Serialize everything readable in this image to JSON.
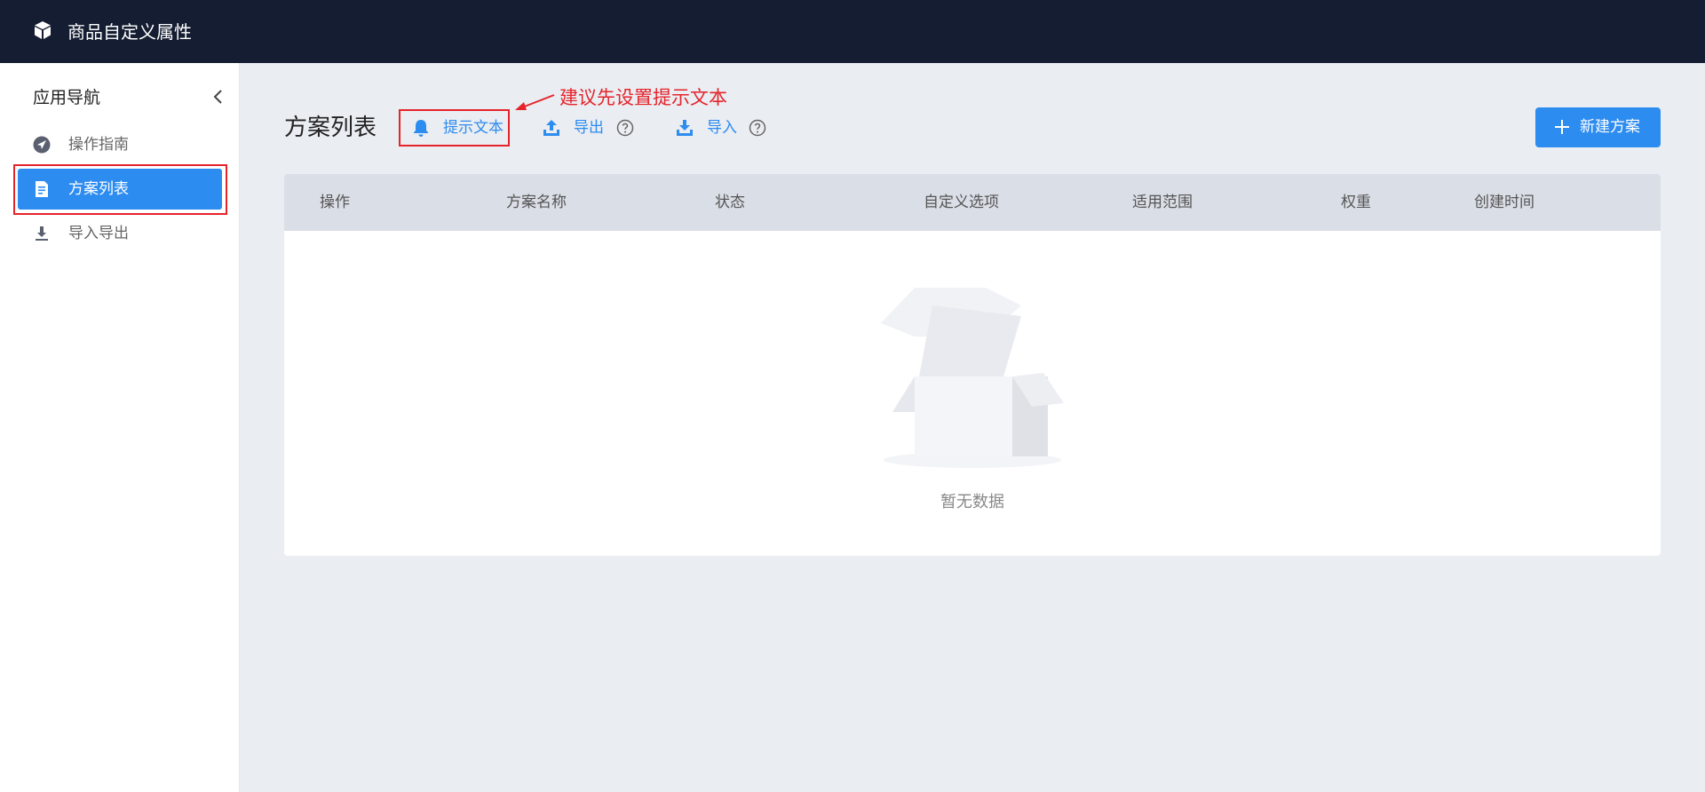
{
  "header": {
    "title": "商品自定义属性",
    "logo_icon": "cube-icon"
  },
  "sidebar": {
    "title": "应用导航",
    "items": [
      {
        "label": "操作指南",
        "icon": "compass-icon",
        "active": false
      },
      {
        "label": "方案列表",
        "icon": "document-icon",
        "active": true
      },
      {
        "label": "导入导出",
        "icon": "download-icon",
        "active": false
      }
    ]
  },
  "main": {
    "title": "方案列表",
    "toolbar": {
      "hint_label": "提示文本",
      "export_label": "导出",
      "import_label": "导入"
    },
    "annotation": "建议先设置提示文本",
    "new_button_label": "新建方案"
  },
  "table": {
    "columns": [
      "操作",
      "方案名称",
      "状态",
      "自定义选项",
      "适用范围",
      "权重",
      "创建时间"
    ],
    "empty_text": "暂无数据"
  },
  "colors": {
    "topbar": "#141d31",
    "accent": "#2d8cf0",
    "highlight_red": "#e5242b",
    "bg": "#eaedf2"
  }
}
